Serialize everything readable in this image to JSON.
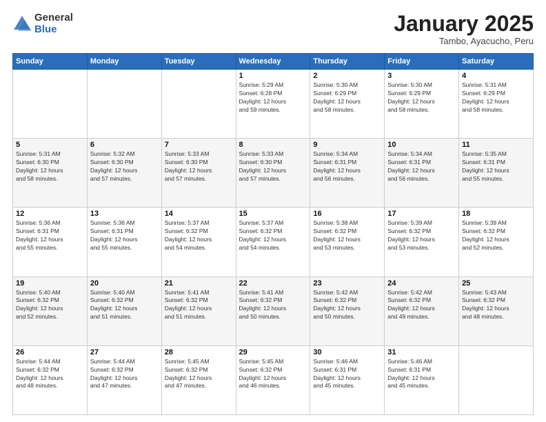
{
  "header": {
    "logo": {
      "general": "General",
      "blue": "Blue"
    },
    "title": "January 2025",
    "location": "Tambo, Ayacucho, Peru"
  },
  "weekdays": [
    "Sunday",
    "Monday",
    "Tuesday",
    "Wednesday",
    "Thursday",
    "Friday",
    "Saturday"
  ],
  "weeks": [
    [
      {
        "day": "",
        "info": ""
      },
      {
        "day": "",
        "info": ""
      },
      {
        "day": "",
        "info": ""
      },
      {
        "day": "1",
        "info": "Sunrise: 5:29 AM\nSunset: 6:28 PM\nDaylight: 12 hours\nand 59 minutes."
      },
      {
        "day": "2",
        "info": "Sunrise: 5:30 AM\nSunset: 6:29 PM\nDaylight: 12 hours\nand 58 minutes."
      },
      {
        "day": "3",
        "info": "Sunrise: 5:30 AM\nSunset: 6:29 PM\nDaylight: 12 hours\nand 58 minutes."
      },
      {
        "day": "4",
        "info": "Sunrise: 5:31 AM\nSunset: 6:29 PM\nDaylight: 12 hours\nand 58 minutes."
      }
    ],
    [
      {
        "day": "5",
        "info": "Sunrise: 5:31 AM\nSunset: 6:30 PM\nDaylight: 12 hours\nand 58 minutes."
      },
      {
        "day": "6",
        "info": "Sunrise: 5:32 AM\nSunset: 6:30 PM\nDaylight: 12 hours\nand 57 minutes."
      },
      {
        "day": "7",
        "info": "Sunrise: 5:33 AM\nSunset: 6:30 PM\nDaylight: 12 hours\nand 57 minutes."
      },
      {
        "day": "8",
        "info": "Sunrise: 5:33 AM\nSunset: 6:30 PM\nDaylight: 12 hours\nand 57 minutes."
      },
      {
        "day": "9",
        "info": "Sunrise: 5:34 AM\nSunset: 6:31 PM\nDaylight: 12 hours\nand 56 minutes."
      },
      {
        "day": "10",
        "info": "Sunrise: 5:34 AM\nSunset: 6:31 PM\nDaylight: 12 hours\nand 56 minutes."
      },
      {
        "day": "11",
        "info": "Sunrise: 5:35 AM\nSunset: 6:31 PM\nDaylight: 12 hours\nand 55 minutes."
      }
    ],
    [
      {
        "day": "12",
        "info": "Sunrise: 5:36 AM\nSunset: 6:31 PM\nDaylight: 12 hours\nand 55 minutes."
      },
      {
        "day": "13",
        "info": "Sunrise: 5:36 AM\nSunset: 6:31 PM\nDaylight: 12 hours\nand 55 minutes."
      },
      {
        "day": "14",
        "info": "Sunrise: 5:37 AM\nSunset: 6:32 PM\nDaylight: 12 hours\nand 54 minutes."
      },
      {
        "day": "15",
        "info": "Sunrise: 5:37 AM\nSunset: 6:32 PM\nDaylight: 12 hours\nand 54 minutes."
      },
      {
        "day": "16",
        "info": "Sunrise: 5:38 AM\nSunset: 6:32 PM\nDaylight: 12 hours\nand 53 minutes."
      },
      {
        "day": "17",
        "info": "Sunrise: 5:39 AM\nSunset: 6:32 PM\nDaylight: 12 hours\nand 53 minutes."
      },
      {
        "day": "18",
        "info": "Sunrise: 5:39 AM\nSunset: 6:32 PM\nDaylight: 12 hours\nand 52 minutes."
      }
    ],
    [
      {
        "day": "19",
        "info": "Sunrise: 5:40 AM\nSunset: 6:32 PM\nDaylight: 12 hours\nand 52 minutes."
      },
      {
        "day": "20",
        "info": "Sunrise: 5:40 AM\nSunset: 6:32 PM\nDaylight: 12 hours\nand 51 minutes."
      },
      {
        "day": "21",
        "info": "Sunrise: 5:41 AM\nSunset: 6:32 PM\nDaylight: 12 hours\nand 51 minutes."
      },
      {
        "day": "22",
        "info": "Sunrise: 5:41 AM\nSunset: 6:32 PM\nDaylight: 12 hours\nand 50 minutes."
      },
      {
        "day": "23",
        "info": "Sunrise: 5:42 AM\nSunset: 6:32 PM\nDaylight: 12 hours\nand 50 minutes."
      },
      {
        "day": "24",
        "info": "Sunrise: 5:42 AM\nSunset: 6:32 PM\nDaylight: 12 hours\nand 49 minutes."
      },
      {
        "day": "25",
        "info": "Sunrise: 5:43 AM\nSunset: 6:32 PM\nDaylight: 12 hours\nand 48 minutes."
      }
    ],
    [
      {
        "day": "26",
        "info": "Sunrise: 5:44 AM\nSunset: 6:32 PM\nDaylight: 12 hours\nand 48 minutes."
      },
      {
        "day": "27",
        "info": "Sunrise: 5:44 AM\nSunset: 6:32 PM\nDaylight: 12 hours\nand 47 minutes."
      },
      {
        "day": "28",
        "info": "Sunrise: 5:45 AM\nSunset: 6:32 PM\nDaylight: 12 hours\nand 47 minutes."
      },
      {
        "day": "29",
        "info": "Sunrise: 5:45 AM\nSunset: 6:32 PM\nDaylight: 12 hours\nand 46 minutes."
      },
      {
        "day": "30",
        "info": "Sunrise: 5:46 AM\nSunset: 6:31 PM\nDaylight: 12 hours\nand 45 minutes."
      },
      {
        "day": "31",
        "info": "Sunrise: 5:46 AM\nSunset: 6:31 PM\nDaylight: 12 hours\nand 45 minutes."
      },
      {
        "day": "",
        "info": ""
      }
    ]
  ]
}
